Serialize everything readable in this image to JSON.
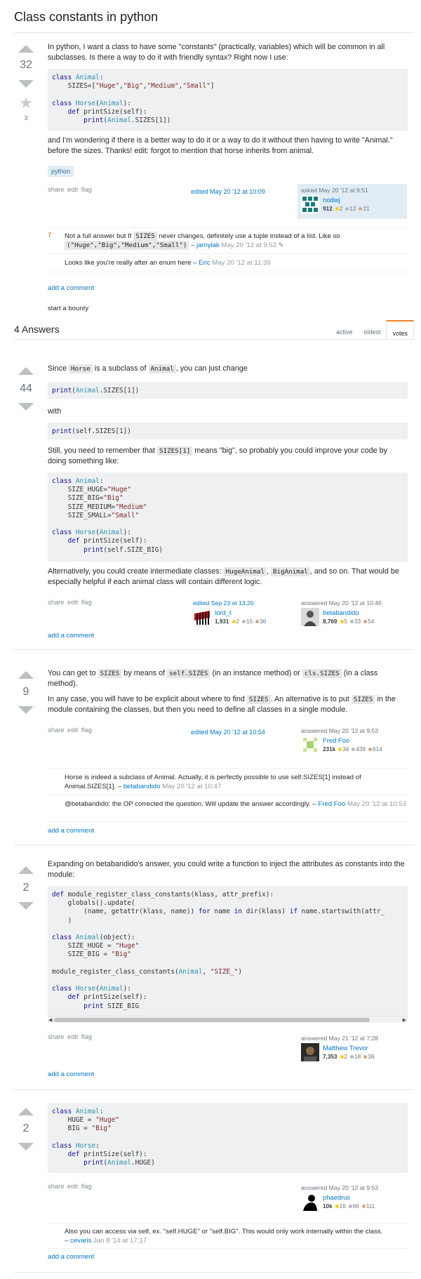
{
  "question": {
    "title": "Class constants in python",
    "score": "32",
    "favorites": "3",
    "para1": "In python, I want a class to have some \"constants\" (practically, variables) which will be common in all subclasses. Is there a way to do it with friendly syntax? Right now I use:",
    "para2": "and I'm wondering if there is a better way to do it or a way to do it without then having to write \"Animal.\" before the sizes. Thanks! edit: forgot to mention that horse inherits from animal.",
    "tag": "python",
    "menu": "share edit flag",
    "edited": "edited May 20 '12 at 10:09",
    "asked": "asked May 20 '12 at 9:51",
    "user": "nodwj",
    "rep": "912",
    "gold": "2",
    "silver": "12",
    "bronze": "21"
  },
  "qcomments": [
    {
      "score": "7",
      "t1": "Not a full answer but If ",
      "code1": "SIZES",
      "t2": " never changes, definitely use a tuple instead of a list. Like so",
      "code2": "(\"Huge\",\"Big\",\"Medium\",\"Small\")",
      "sep": " – ",
      "user": "jamylak",
      "date": "May 20 '12 at 9:53"
    },
    {
      "text": "Looks like you're really after an enum here – ",
      "user": "Eric",
      "date": "May 20 '12 at 11:39"
    }
  ],
  "add_comment": "add a comment",
  "start_bounty": "start a bounty",
  "answers_header": "4 Answers",
  "tabs": [
    "active",
    "oldest",
    "votes"
  ],
  "a1": {
    "score": "44",
    "p1a": "Since ",
    "p1b": "Horse",
    "p1c": " is a subclass of ",
    "p1d": "Animal",
    "p1e": ", you can just change",
    "with": "with",
    "p3a": "Still, you need to remember that ",
    "p3b": "SIZES[1]",
    "p3c": " means \"big\", so probably you could improve your code by doing something like:",
    "p4a": "Alternatively, you could create intermediate classes: ",
    "p4b": "HugeAnimal",
    "p4c": ", ",
    "p4d": "BigAnimal",
    "p4e": ", and so on. That would be especially helpful if each animal class will contain different logic.",
    "menu": "share edit flag",
    "editor": {
      "label": "edited Sep 23 at 13:20",
      "name": "lord_t",
      "rep": "1,931",
      "gold": "2",
      "silver": "15",
      "bronze": "36"
    },
    "author": {
      "label": "answered May 20 '12 at 10:46",
      "name": "betabandido",
      "rep": "8,769",
      "gold": "5",
      "silver": "33",
      "bronze": "54"
    }
  },
  "a2": {
    "score": "9",
    "p1a": "You can get to ",
    "p1b": "SIZES",
    "p1c": " by means of ",
    "p1d": "self.SIZES",
    "p1e": " (in an instance method) or ",
    "p1f": "cls.SIZES",
    "p1g": " (in a class method).",
    "p2a": "In any case, you will have to be explicit about where to find ",
    "p2b": "SIZES",
    "p2c": ". An alternative is to put ",
    "p2d": "SIZES",
    "p2e": " in the module containing the classes, but then you need to define all classes in a single module.",
    "menu": "share edit flag",
    "edited": "edited May 20 '12 at 10:54",
    "author": {
      "label": "answered May 20 '12 at 9:53",
      "name": "Fred Foo",
      "rep": "231k",
      "gold": "34",
      "silver": "439",
      "bronze": "614"
    },
    "c1": {
      "text": "Horse is indeed a subclass of Animal. Actually, it is perfectly possible to use self.SIZES[1] instead of Animal.SIZES[1]. – ",
      "user": "betabandido",
      "date": "May 20 '12 at 10:47"
    },
    "c2": {
      "text": "@betabandido: the OP corrected the question. Will update the answer accordingly. – ",
      "user": "Fred Foo",
      "date": "May 20 '12 at 10:53"
    }
  },
  "a3": {
    "score": "2",
    "p1": "Expanding on betabandido's answer, you could write a function to inject the attributes as constants into the module:",
    "menu": "share edit flag",
    "author": {
      "label": "answered May 21 '12 at 7:28",
      "name": "Matthew Trevor",
      "rep": "7,353",
      "gold": "2",
      "silver": "18",
      "bronze": "38"
    }
  },
  "a4": {
    "score": "2",
    "menu": "share edit flag",
    "author": {
      "label": "answered May 20 '12 at 9:53",
      "name": "phaedrus",
      "rep": "10k",
      "gold": "16",
      "silver": "66",
      "bronze": "111"
    },
    "c1": {
      "text": "Also you can access via self, ex. \"self.HUGE\" or \"self.BIG\". This would only work internally within the class.",
      "sep": "– ",
      "user": "cevaris",
      "date": "Jan 8 '14 at 17:17"
    }
  },
  "code": {
    "q": [
      [
        "class ",
        "Animal",
        ":"
      ],
      [
        "    SIZES=[",
        "\"Huge\"",
        ",",
        "\"Big\"",
        ",",
        "\"Medium\"",
        ",",
        "\"Small\"",
        "]"
      ],
      [
        "class ",
        "Horse",
        "(",
        "Animal",
        "):"
      ],
      [
        "    def printSize(self):"
      ],
      [
        "        print(",
        "Animal",
        ".SIZES[1])"
      ]
    ],
    "a1_1": "print(Animal.SIZES[1])",
    "a1_2": "print(self.SIZES[1])",
    "a1_3": "class Animal:\n    SIZE_HUGE=\"Huge\"\n    SIZE_BIG=\"Big\"\n    SIZE_MEDIUM=\"Medium\"\n    SIZE_SMALL=\"Small\"\n\nclass Horse(Animal):\n    def printSize(self):\n        print(self.SIZE_BIG)",
    "a3": "def module_register_class_constants(klass, attr_prefix):\n    globals().update(\n        (name, getattr(klass, name)) for name in dir(klass) if name.startswith(attr_\n    )\n\nclass Animal(object):\n    SIZE_HUGE = \"Huge\"\n    SIZE_BIG = \"Big\"\n\nmodule_register_class_constants(Animal, \"SIZE_\")\n\nclass Horse(Animal):\n    def printSize(self):\n        print SIZE_BIG",
    "a4": "class Animal:\n    HUGE = \"Huge\"\n    BIG = \"Big\"\n\nclass Horse:\n    def printSize(self):\n        print(Animal.HUGE)"
  }
}
